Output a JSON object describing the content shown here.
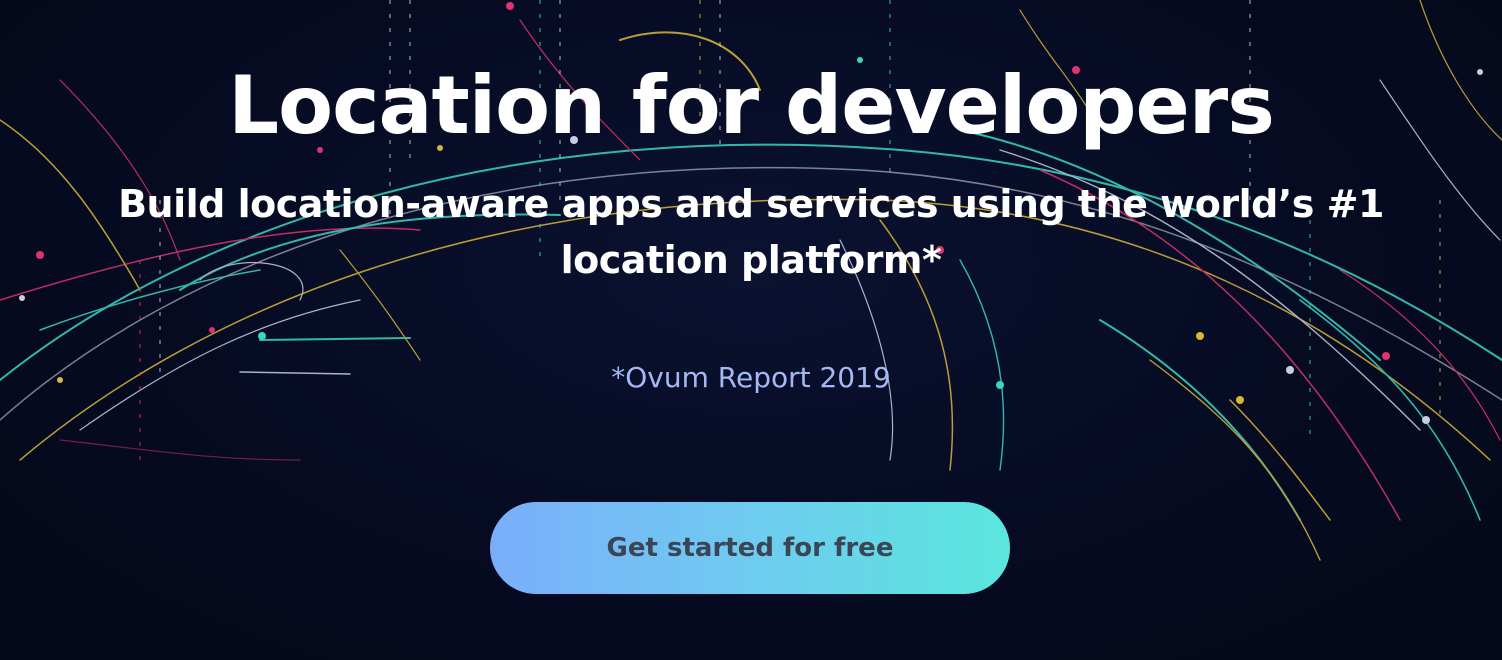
{
  "hero": {
    "title": "Location for developers",
    "subtitle": "Build location-aware apps and services using the world’s #1 location platform*",
    "footnote": "*Ovum Report 2019",
    "cta_label": "Get started for free"
  },
  "colors": {
    "background": "#050a1e",
    "title_text": "#ffffff",
    "footnote_text": "#a4b9f3",
    "cta_gradient_start": "#7aaefb",
    "cta_gradient_end": "#5ae6dc",
    "cta_text": "#3a4555",
    "line_teal": "#3ad6c0",
    "line_yellow": "#d9b73a",
    "line_pink": "#e0336f",
    "line_white": "#c8d0e0"
  }
}
